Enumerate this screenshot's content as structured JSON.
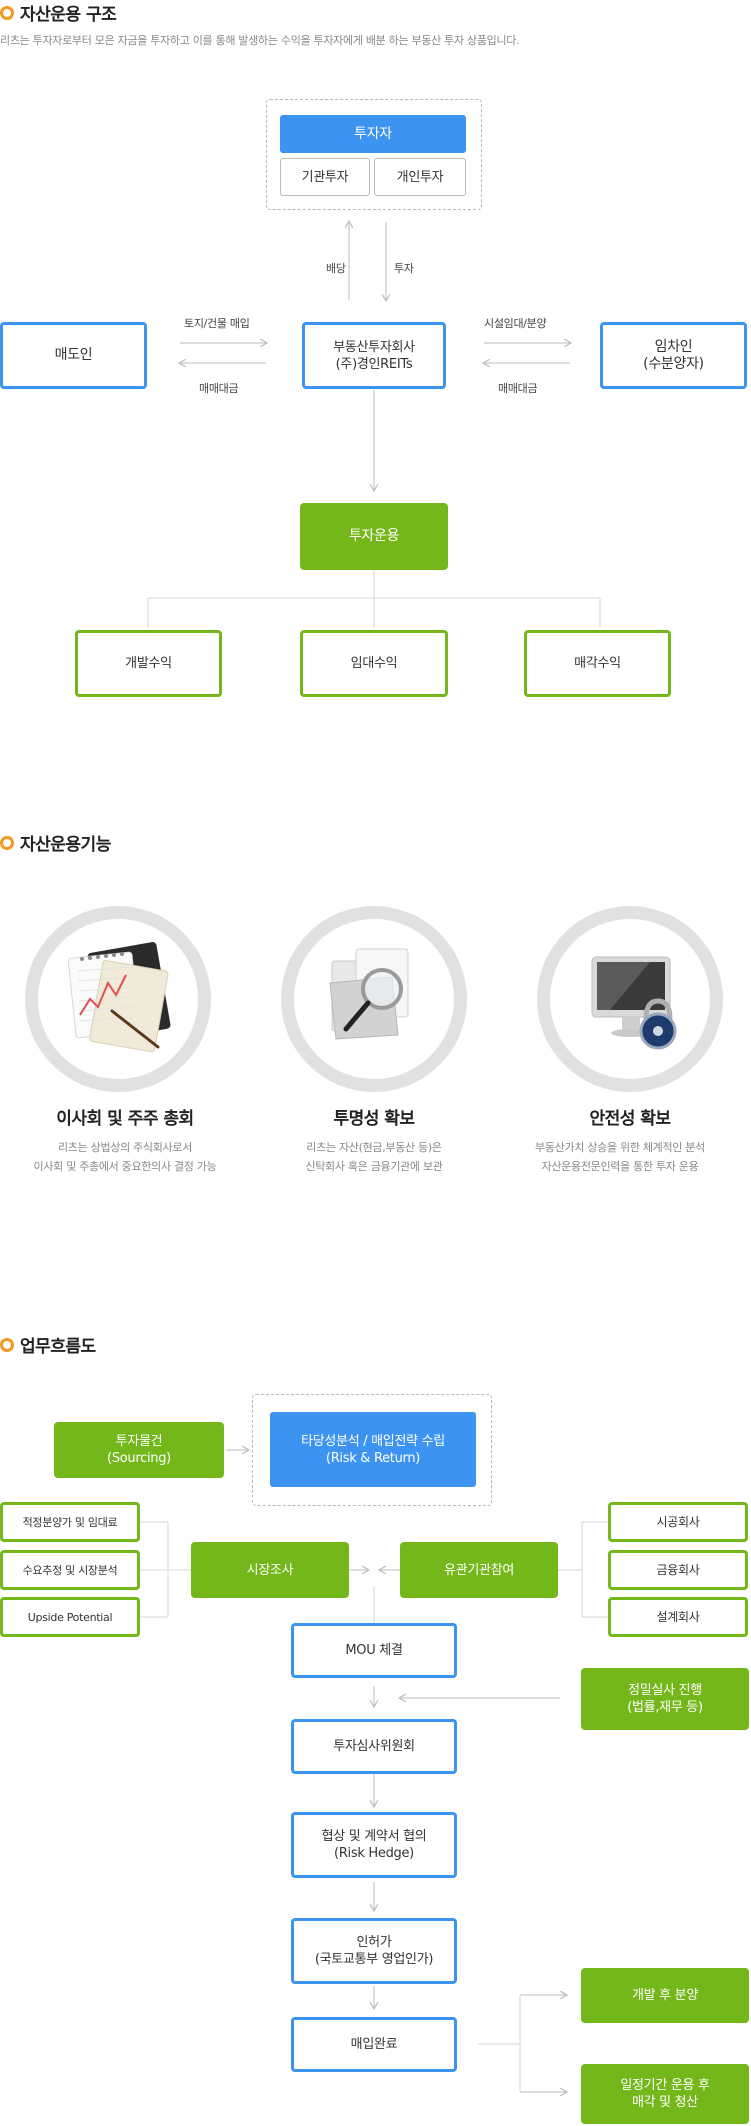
{
  "section1": {
    "title": "자산운용 구조",
    "intro": "리츠는 투자자로부터 모은 자금을 투자하고 이를 통해 발생하는 수익을 투자자에게 배분 하는 부동산 투자 상품입니다.",
    "investor": "투자자",
    "institutional": "기관투자",
    "individual": "개인투자",
    "dividend": "배당",
    "invest": "투자",
    "seller": "매도인",
    "land_purchase": "토지/건물 매입",
    "sale_price_left": "매매대금",
    "company": "부동산투자회사\n(주)경인REITs",
    "lease": "시설임대/분양",
    "sale_price_right": "매매대금",
    "tenant": "임차인\n(수분양자)",
    "operation": "투자운용",
    "dev_income": "개발수익",
    "rent_income": "임대수익",
    "sale_income": "매각수익"
  },
  "section2": {
    "title": "자산운용기능",
    "items": [
      {
        "title": "이사회 및 주주 총회",
        "desc": "리츠는 상법상의 주식회사로서\n이사회 및 주총에서 중요한의사 결정 가능",
        "icon": "chart-notebook-icon"
      },
      {
        "title": "투명성 확보",
        "desc": "리츠는 자산(현금,부동산 등)은\n신탁회사 혹은 금융기관에 보관",
        "icon": "magnifier-folder-icon"
      },
      {
        "title": "안전성 확보",
        "desc": "부동산가치 상승을 위한 체계적인 분석\n자산운용전문인력을 통한 투자 운용",
        "icon": "monitor-lock-icon"
      }
    ]
  },
  "section3": {
    "title": "업무흐름도",
    "sourcing": "투자물건\n(Sourcing)",
    "feasibility": "타당성분석 / 매입전략 수립\n(Risk & Return)",
    "left_items": [
      "적정분양가 및 임대료",
      "수요추정 및 시장분석",
      "Upside Potential"
    ],
    "market": "시장조사",
    "institution": "유관기관참여",
    "right_items": [
      "시공회사",
      "금융회사",
      "설계회사"
    ],
    "mou": "MOU 체결",
    "due_diligence": "정밀실사 진행\n(법률,재무 등)",
    "committee": "투자심사위원회",
    "negotiation": "협상 및 계약서 협의\n(Risk Hedge)",
    "permit": "인허가\n(국토교통부 영업인가)",
    "purchase": "매입완료",
    "dev_sale": "개발 후 분양",
    "long_term": "일정기간 운용 후\n매각 및 청산"
  },
  "colors": {
    "blue": "#3d94f0",
    "green": "#74b71b",
    "orange": "#f29a1e",
    "grey": "#d6d6d6"
  }
}
